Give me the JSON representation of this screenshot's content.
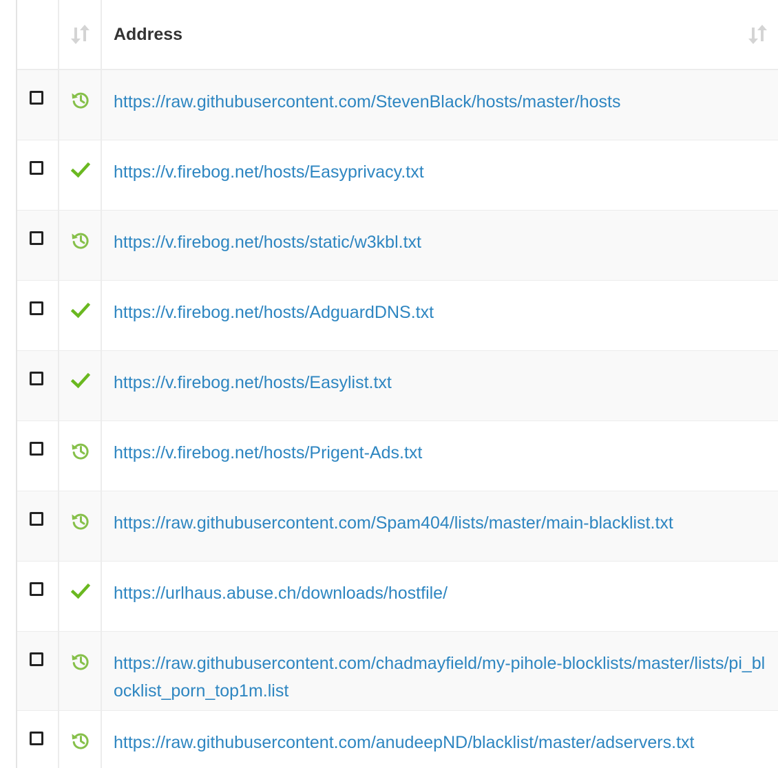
{
  "table": {
    "header": {
      "status_sort_icon": "sort-icon",
      "address_label": "Address",
      "address_sort_icon": "sort-icon"
    },
    "colors": {
      "link": "#2e86c1",
      "status_enabled": "#6ab820",
      "status_pending": "#86c04a",
      "checkbox": "#222222"
    },
    "rows": [
      {
        "checked": false,
        "status": "history-icon",
        "address": "https://raw.githubusercontent.com/StevenBlack/hosts/master/hosts"
      },
      {
        "checked": false,
        "status": "check-icon",
        "address": "https://v.firebog.net/hosts/Easyprivacy.txt"
      },
      {
        "checked": false,
        "status": "history-icon",
        "address": "https://v.firebog.net/hosts/static/w3kbl.txt"
      },
      {
        "checked": false,
        "status": "check-icon",
        "address": "https://v.firebog.net/hosts/AdguardDNS.txt"
      },
      {
        "checked": false,
        "status": "check-icon",
        "address": "https://v.firebog.net/hosts/Easylist.txt"
      },
      {
        "checked": false,
        "status": "history-icon",
        "address": "https://v.firebog.net/hosts/Prigent-Ads.txt"
      },
      {
        "checked": false,
        "status": "history-icon",
        "address": "https://raw.githubusercontent.com/Spam404/lists/master/main-blacklist.txt"
      },
      {
        "checked": false,
        "status": "check-icon",
        "address": "https://urlhaus.abuse.ch/downloads/hostfile/"
      },
      {
        "checked": false,
        "status": "history-icon",
        "address": "https://raw.githubusercontent.com/chadmayfield/my-pihole-blocklists/master/lists/pi_blocklist_porn_top1m.list"
      },
      {
        "checked": false,
        "status": "history-icon",
        "address": "https://raw.githubusercontent.com/anudeepND/blacklist/master/adservers.txt"
      }
    ]
  }
}
